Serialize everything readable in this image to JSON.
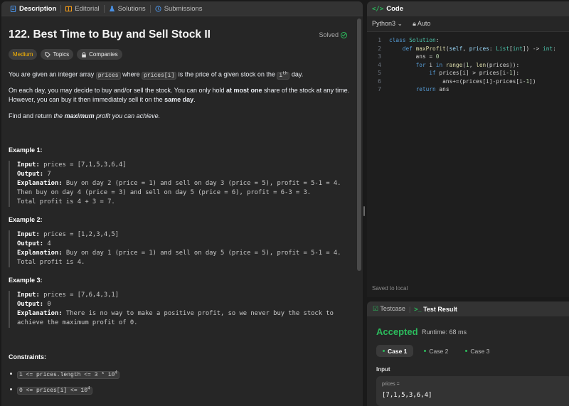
{
  "tabs": {
    "description": "Description",
    "editorial": "Editorial",
    "solutions": "Solutions",
    "submissions": "Submissions"
  },
  "problem": {
    "title": "122. Best Time to Buy and Sell Stock II",
    "status": "Solved",
    "difficulty": "Medium",
    "topics": "Topics",
    "companies": "Companies",
    "p1_a": "You are given an integer array ",
    "p1_code1": "prices",
    "p1_b": " where ",
    "p1_code2": "prices[i]",
    "p1_c": " is the price of a given stock on the ",
    "p1_sup_base": "i",
    "p1_sup": "th",
    "p1_d": " day.",
    "p2_a": "On each day, you may decide to buy and/or sell the stock. You can only hold ",
    "p2_bold": "at most one",
    "p2_b": " share of the stock at any time.",
    "p2_c": "However, you can buy it then immediately sell it on the ",
    "p2_bold2": "same day",
    "p2_d": ".",
    "p3_a": "Find and return ",
    "p3_it": "the ",
    "p3_bold": "maximum",
    "p3_b": " profit you can achieve."
  },
  "examples": [
    {
      "head": "Example 1:",
      "input_label": "Input:",
      "input": " prices = [7,1,5,3,6,4]",
      "output_label": "Output:",
      "output": " 7",
      "expl_label": "Explanation:",
      "expl1": " Buy on day 2 (price = 1) and sell on day 3 (price = 5), profit = 5-1 = 4.",
      "expl2": "Then buy on day 4 (price = 3) and sell on day 5 (price = 6), profit = 6-3 = 3.",
      "expl3": "Total profit is 4 + 3 = 7."
    },
    {
      "head": "Example 2:",
      "input_label": "Input:",
      "input": " prices = [1,2,3,4,5]",
      "output_label": "Output:",
      "output": " 4",
      "expl_label": "Explanation:",
      "expl1": " Buy on day 1 (price = 1) and sell on day 5 (price = 5), profit = 5-1 = 4.",
      "expl2": "Total profit is 4."
    },
    {
      "head": "Example 3:",
      "input_label": "Input:",
      "input": " prices = [7,6,4,3,1]",
      "output_label": "Output:",
      "output": " 0",
      "expl_label": "Explanation:",
      "expl1": " There is no way to make a positive profit, so we never buy the stock to",
      "expl2": "achieve the maximum profit of 0."
    }
  ],
  "constraints": {
    "head": "Constraints:",
    "c1": "1 <= prices.length <= 3 * 10",
    "c1_sup": "4",
    "c2": "0 <= prices[i] <= 10",
    "c2_sup": "4"
  },
  "code": {
    "title": "Code",
    "language": "Python3",
    "mode": "Auto",
    "lines": [
      "1",
      "2",
      "3",
      "4",
      "5",
      "6",
      "7"
    ],
    "saved": "Saved to local"
  },
  "result": {
    "testcase_tab": "Testcase",
    "result_tab": "Test Result",
    "verdict": "Accepted",
    "runtime": "Runtime: 68 ms",
    "case1": "Case 1",
    "case2": "Case 2",
    "case3": "Case 3",
    "input_label": "Input",
    "var": "prices =",
    "value": "[7,1,5,3,6,4]"
  },
  "colors": {
    "accent_green": "#2cbb5d",
    "medium": "#ffb800"
  }
}
